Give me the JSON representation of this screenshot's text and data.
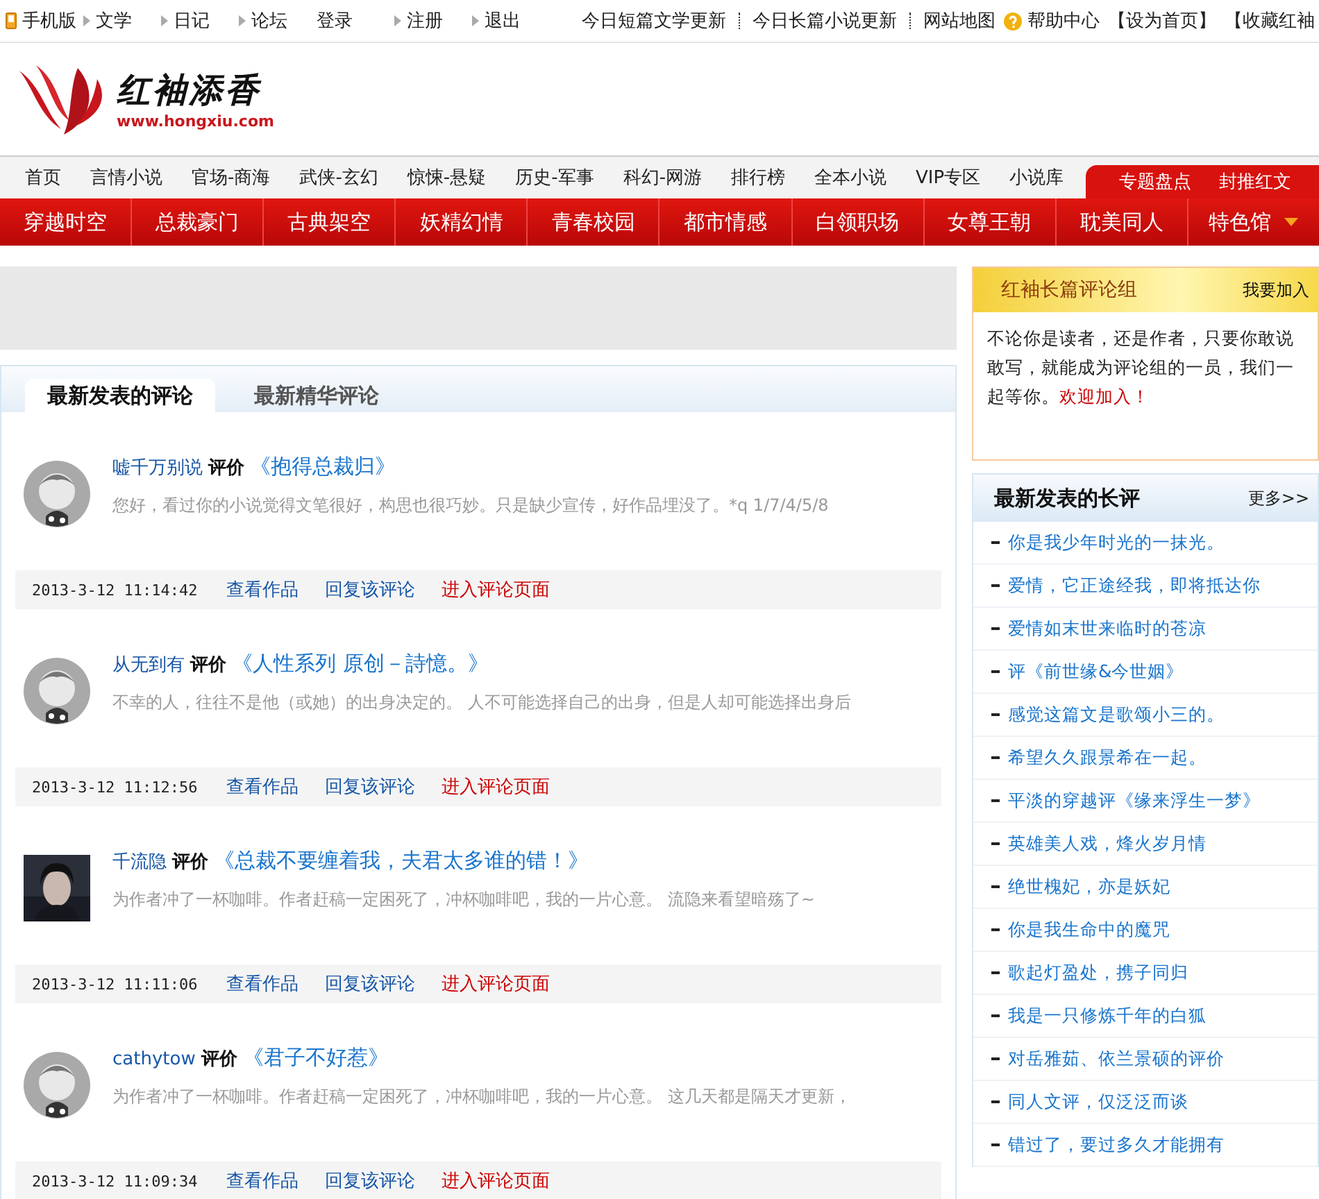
{
  "top_bar": {
    "left_links": [
      {
        "label": "手机版",
        "kind": "phone"
      },
      {
        "label": "文学",
        "kind": "arrow"
      },
      {
        "label": "日记",
        "kind": "arrow"
      },
      {
        "label": "论坛",
        "kind": "arrow"
      },
      {
        "label": "登录",
        "kind": "plain"
      },
      {
        "label": "注册",
        "kind": "arrow"
      },
      {
        "label": "退出",
        "kind": "arrow"
      }
    ],
    "right_links": [
      {
        "label": "今日短篇文学更新",
        "kind": "sep"
      },
      {
        "label": "今日长篇小说更新",
        "kind": "sep"
      },
      {
        "label": "网站地图",
        "kind": "plain"
      },
      {
        "label": "帮助中心",
        "kind": "help"
      },
      {
        "label": "【设为首页】",
        "kind": "plain"
      },
      {
        "label": "【收藏红袖",
        "kind": "plain"
      }
    ]
  },
  "logo": {
    "name": "红袖添香",
    "url": "www.hongxiu.com"
  },
  "main_nav": [
    "首页",
    "言情小说",
    "官场-商海",
    "武侠-玄幻",
    "惊悚-悬疑",
    "历史-军事",
    "科幻-网游",
    "排行榜",
    "全本小说",
    "VIP专区",
    "小说库"
  ],
  "special_nav": [
    "专题盘点",
    "封推红文"
  ],
  "category_nav": [
    {
      "label": "穿越时空",
      "dropdown": false
    },
    {
      "label": "总裁豪门",
      "dropdown": false
    },
    {
      "label": "古典架空",
      "dropdown": false
    },
    {
      "label": "妖精幻情",
      "dropdown": false
    },
    {
      "label": "青春校园",
      "dropdown": false
    },
    {
      "label": "都市情感",
      "dropdown": false
    },
    {
      "label": "白领职场",
      "dropdown": false
    },
    {
      "label": "女尊王朝",
      "dropdown": false
    },
    {
      "label": "耽美同人",
      "dropdown": false
    },
    {
      "label": "特色馆",
      "dropdown": true
    }
  ],
  "tabs": [
    {
      "label": "最新发表的评论",
      "selected": true
    },
    {
      "label": "最新精华评论",
      "selected": false
    }
  ],
  "comments": [
    {
      "user": "嘘千万别说",
      "kind": "cartoon",
      "verb": "评价",
      "title": "《抱得总裁归》",
      "text": "您好，看过你的小说觉得文笔很好，构思也很巧妙。只是缺少宣传，好作品埋没了。*q 1/7/4/5/8",
      "date": "2013-3-12 11:14:42",
      "actions": [
        {
          "label": "查看作品",
          "kind": "normal"
        },
        {
          "label": "回复该评论",
          "kind": "normal"
        },
        {
          "label": "进入评论页面",
          "kind": "highlight"
        }
      ]
    },
    {
      "user": "从无到有",
      "kind": "cartoon",
      "verb": "评价",
      "title": "《人性系列 原创－詩憶。》",
      "text": "不幸的人，往往不是他（或她）的出身决定的。 人不可能选择自己的出身，但是人却可能选择出身后",
      "date": "2013-3-12 11:12:56",
      "actions": [
        {
          "label": "查看作品",
          "kind": "normal"
        },
        {
          "label": "回复该评论",
          "kind": "normal"
        },
        {
          "label": "进入评论页面",
          "kind": "highlight"
        }
      ]
    },
    {
      "user": "千流隐",
      "kind": "picture",
      "verb": "评价",
      "title": "《总裁不要缠着我，夫君太多谁的错！》",
      "text": "为作者冲了一杯咖啡。作者赶稿一定困死了，冲杯咖啡吧，我的一片心意。 流隐来看望暗殇了~",
      "date": "2013-3-12 11:11:06",
      "actions": [
        {
          "label": "查看作品",
          "kind": "normal"
        },
        {
          "label": "回复该评论",
          "kind": "normal"
        },
        {
          "label": "进入评论页面",
          "kind": "highlight"
        }
      ]
    },
    {
      "user": "cathytow",
      "kind": "cartoon",
      "verb": "评价",
      "title": "《君子不好惹》",
      "text": "为作者冲了一杯咖啡。作者赶稿一定困死了，冲杯咖啡吧，我的一片心意。 这几天都是隔天才更新，",
      "date": "2013-3-12 11:09:34",
      "actions": [
        {
          "label": "查看作品",
          "kind": "normal"
        },
        {
          "label": "回复该评论",
          "kind": "normal"
        },
        {
          "label": "进入评论页面",
          "kind": "highlight"
        }
      ]
    }
  ],
  "group_box": {
    "title": "红袖长篇评论组",
    "join": "我要加入",
    "text": "不论你是读者，还是作者，只要你敢说敢写，就能成为评论组的一员，我们一起等你。",
    "invite": "欢迎加入！"
  },
  "long_reviews": {
    "title": "最新发表的长评",
    "more": "更多>>",
    "items": [
      "你是我少年时光的一抹光。",
      "爱情，它正途经我，即将抵达你",
      "爱情如末世来临时的苍凉",
      "评《前世缘&今世姻》",
      "感觉这篇文是歌颂小三的。",
      "希望久久跟景希在一起。",
      "平淡的穿越评《缘来浮生一梦》",
      "英雄美人戏，烽火岁月情",
      "绝世槐妃，亦是妖妃",
      "你是我生命中的魔咒",
      "歌起灯盈处，携子同归",
      "我是一只修炼千年的白狐",
      "对岳雅茹、依兰景硕的评价",
      "同人文评，仅泛泛而谈",
      "错过了，要过多久才能拥有"
    ]
  }
}
